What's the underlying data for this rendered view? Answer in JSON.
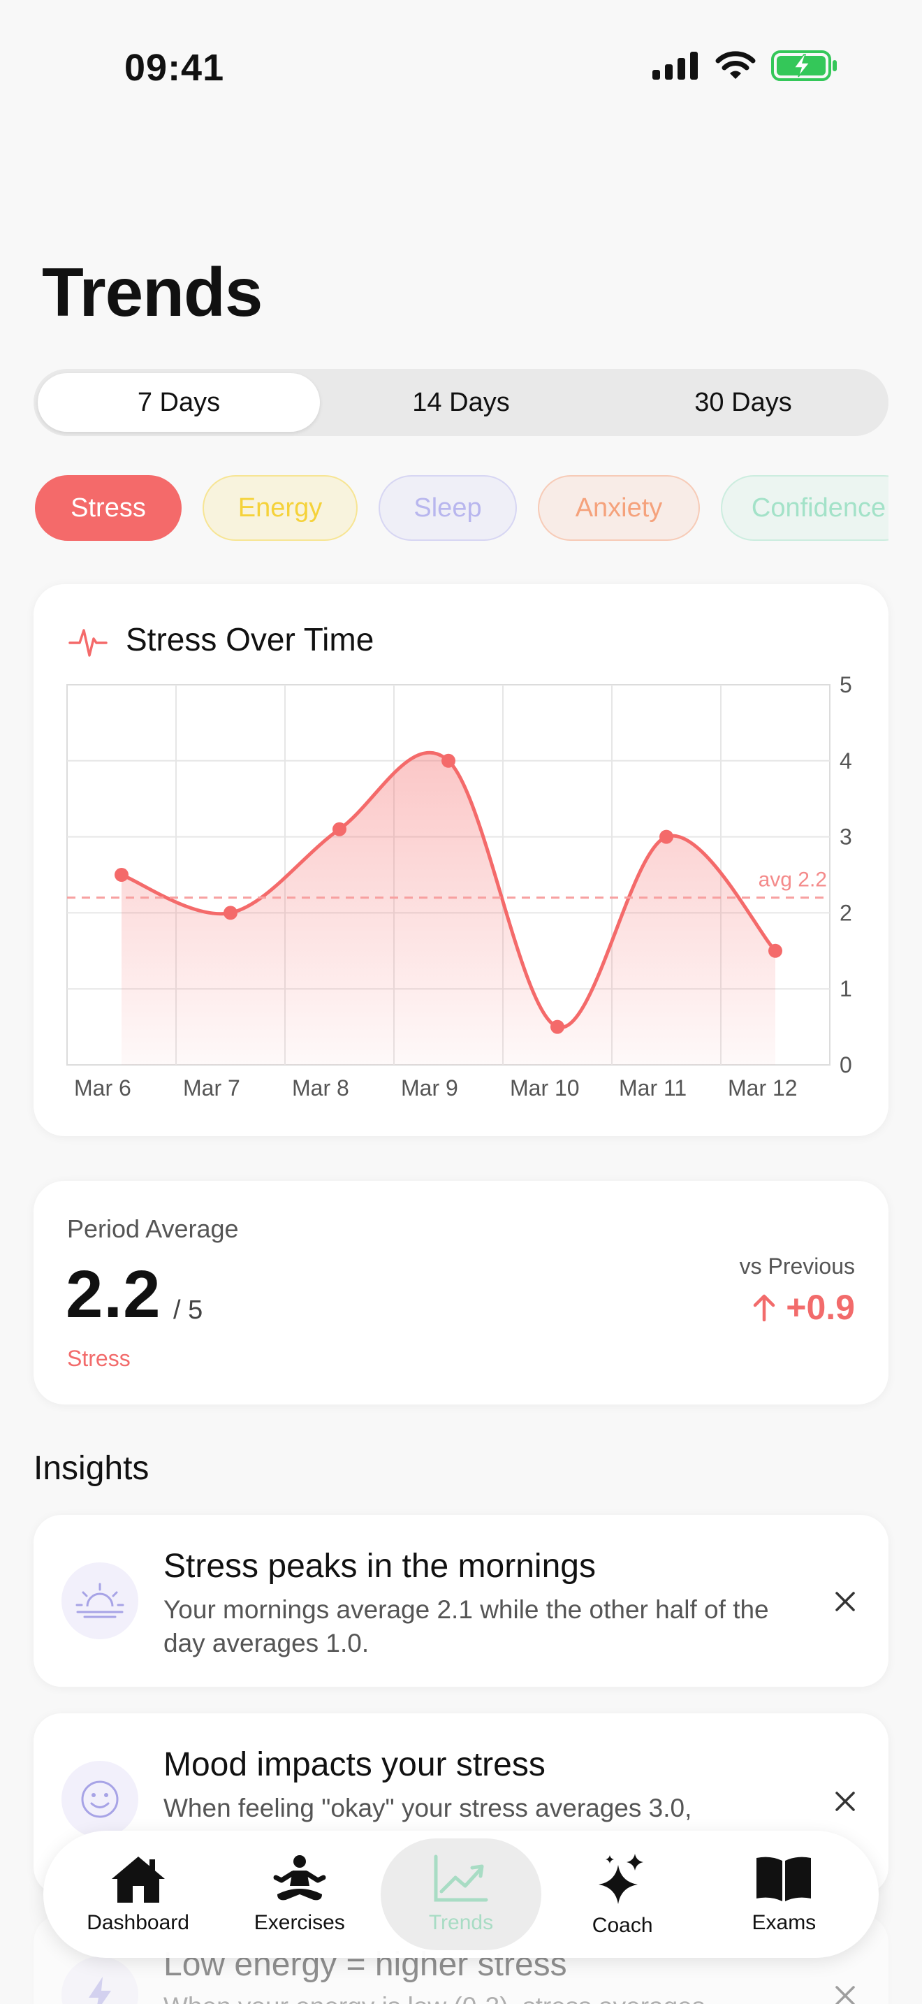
{
  "status_bar": {
    "time": "09:41"
  },
  "page": {
    "title": "Trends"
  },
  "range_tabs": [
    {
      "label": "7 Days",
      "active": true
    },
    {
      "label": "14 Days",
      "active": false
    },
    {
      "label": "30 Days",
      "active": false
    }
  ],
  "metric_chips": [
    {
      "label": "Stress",
      "active": true,
      "color": "#f46a6a"
    },
    {
      "label": "Energy",
      "active": false,
      "color": "#f5d23a"
    },
    {
      "label": "Sleep",
      "active": false,
      "color": "#b8b6ee"
    },
    {
      "label": "Anxiety",
      "active": false,
      "color": "#f5a27c"
    },
    {
      "label": "Confidence",
      "active": false,
      "color": "#a3e2c8"
    }
  ],
  "chart": {
    "title": "Stress Over Time",
    "icon": "heartbeat-icon",
    "avg_label": "avg 2.2"
  },
  "chart_data": {
    "type": "area",
    "title": "Stress Over Time",
    "categories": [
      "Mar 6",
      "Mar 7",
      "Mar 8",
      "Mar 9",
      "Mar 10",
      "Mar 11",
      "Mar 12"
    ],
    "series": [
      {
        "values": [
          2.5,
          2.0,
          3.1,
          4.0,
          0.5,
          3.0,
          1.5
        ]
      }
    ],
    "average": 2.2,
    "ylim": [
      0,
      5
    ],
    "yticks": [
      "0",
      "1",
      "2",
      "3",
      "4",
      "5"
    ],
    "grid": true,
    "color": "#f46a6a"
  },
  "period_average": {
    "label": "Period Average",
    "value": "2.2",
    "scale": "/ 5",
    "metric": "Stress",
    "vs_label": "vs Previous",
    "vs_delta": "+0.9",
    "vs_icon": "arrow-up-icon"
  },
  "insights_title": "Insights",
  "insights": [
    {
      "icon": "sunrise-icon",
      "title": "Stress peaks in the mornings",
      "body": "Your mornings average 2.1 while the other half of the day averages 1.0."
    },
    {
      "icon": "smiley-icon",
      "title": "Mood impacts your stress",
      "body": "When feeling \"okay\" your stress averages 3.0,"
    },
    {
      "icon": "lightning-icon",
      "title": "Low energy = higher stress",
      "body": "When your energy is low (0-3), stress averages"
    }
  ],
  "nav": [
    {
      "label": "Dashboard",
      "icon": "house-icon",
      "active": false
    },
    {
      "label": "Exercises",
      "icon": "meditation-icon",
      "active": false
    },
    {
      "label": "Trends",
      "icon": "trend-chart-icon",
      "active": true
    },
    {
      "label": "Coach",
      "icon": "sparkles-icon",
      "active": false
    },
    {
      "label": "Exams",
      "icon": "book-icon",
      "active": false
    }
  ]
}
